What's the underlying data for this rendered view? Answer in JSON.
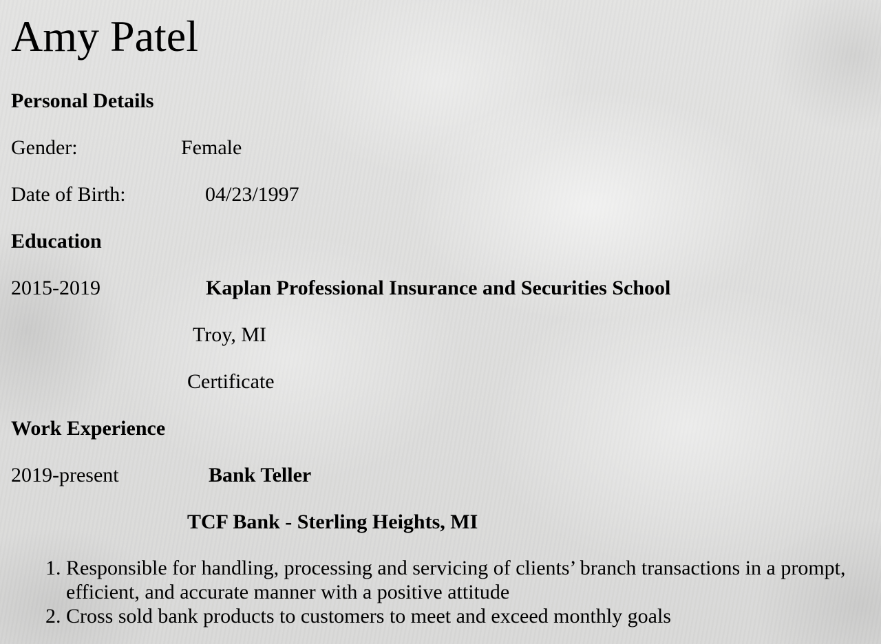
{
  "name": "Amy Patel",
  "sections": {
    "personal_details": "Personal Details",
    "education": "Education",
    "work_experience": "Work Experience"
  },
  "personal": {
    "gender_label": "Gender:",
    "gender_value": "Female",
    "dob_label": "Date of Birth:",
    "dob_value": "04/23/1997"
  },
  "education": {
    "years": "2015-2019",
    "school": "Kaplan Professional Insurance and Securities School",
    "location": "Troy, MI",
    "credential": "Certificate"
  },
  "work": {
    "years": "2019-present",
    "title": "Bank Teller",
    "employer": "TCF Bank - Sterling Heights, MI",
    "duties": [
      "Responsible for handling, processing and servicing of clients’ branch transactions in a prompt, efficient, and accurate manner with a positive attitude",
      "Cross sold bank products to customers to meet and exceed monthly goals"
    ]
  }
}
